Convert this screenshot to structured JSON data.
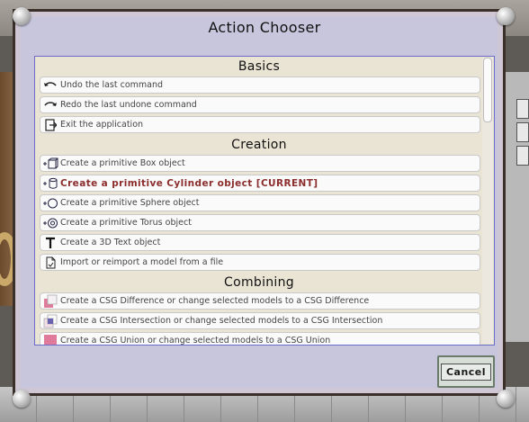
{
  "dialog": {
    "title": "Action Chooser",
    "cancel_label": "Cancel"
  },
  "sections": [
    {
      "header": "Basics",
      "items": [
        {
          "label": "Undo the last command",
          "icon": "undo-icon"
        },
        {
          "label": "Redo the last undone command",
          "icon": "redo-icon"
        },
        {
          "label": "Exit the application",
          "icon": "exit-icon"
        }
      ]
    },
    {
      "header": "Creation",
      "items": [
        {
          "label": "Create a primitive Box object",
          "icon": "box-icon"
        },
        {
          "label": "Create a primitive Cylinder object [CURRENT]",
          "icon": "cylinder-icon",
          "current": true
        },
        {
          "label": "Create a primitive Sphere object",
          "icon": "sphere-icon"
        },
        {
          "label": "Create a primitive Torus object",
          "icon": "torus-icon"
        },
        {
          "label": "Create a 3D Text object",
          "icon": "text-icon"
        },
        {
          "label": "Import or reimport a model from a file",
          "icon": "import-file-icon"
        }
      ]
    },
    {
      "header": "Combining",
      "items": [
        {
          "label": "Create a CSG Difference or change selected models to a CSG Difference",
          "icon": "csg-difference-icon"
        },
        {
          "label": "Create a CSG Intersection or change selected models to a CSG Intersection",
          "icon": "csg-intersection-icon"
        },
        {
          "label": "Create a CSG Union or change selected models to a CSG Union",
          "icon": "csg-union-icon"
        }
      ]
    }
  ],
  "colors": {
    "current_item_text": "#8c2d2d",
    "list_background": "#eae4d4",
    "dialog_background": "#c8c6dd"
  }
}
